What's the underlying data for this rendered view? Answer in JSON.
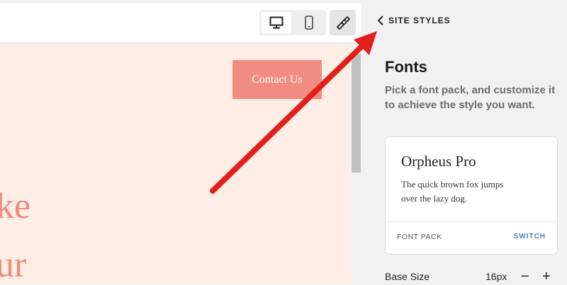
{
  "editor": {
    "view_toggle": {
      "desktop_icon": "desktop-icon",
      "mobile_icon": "mobile-icon"
    },
    "style_icon": "paintbrush-icon",
    "preview": {
      "contact_label": "Contact Us",
      "hero_line_1": "ke",
      "hero_line_2": "ur"
    }
  },
  "panel": {
    "back_label": "SITE STYLES",
    "title": "Fonts",
    "description": "Pick a font pack, and customize it to achieve the style you want.",
    "font_card": {
      "font_name": "Orpheus Pro",
      "sample_line_1": "The quick brown fox jumps",
      "sample_line_2": "over the lazy dog.",
      "pack_label": "FONT PACK",
      "switch_label": "SWITCH"
    },
    "base_size": {
      "label": "Base Size",
      "value": "16px",
      "minus": "−",
      "plus": "+"
    }
  },
  "colors": {
    "accent_button": "#f08c80",
    "preview_bg": "#fdede4",
    "hero_text": "#ef8a7d",
    "link_blue": "#4a7ec7",
    "annotation_arrow": "#e31e1e"
  }
}
